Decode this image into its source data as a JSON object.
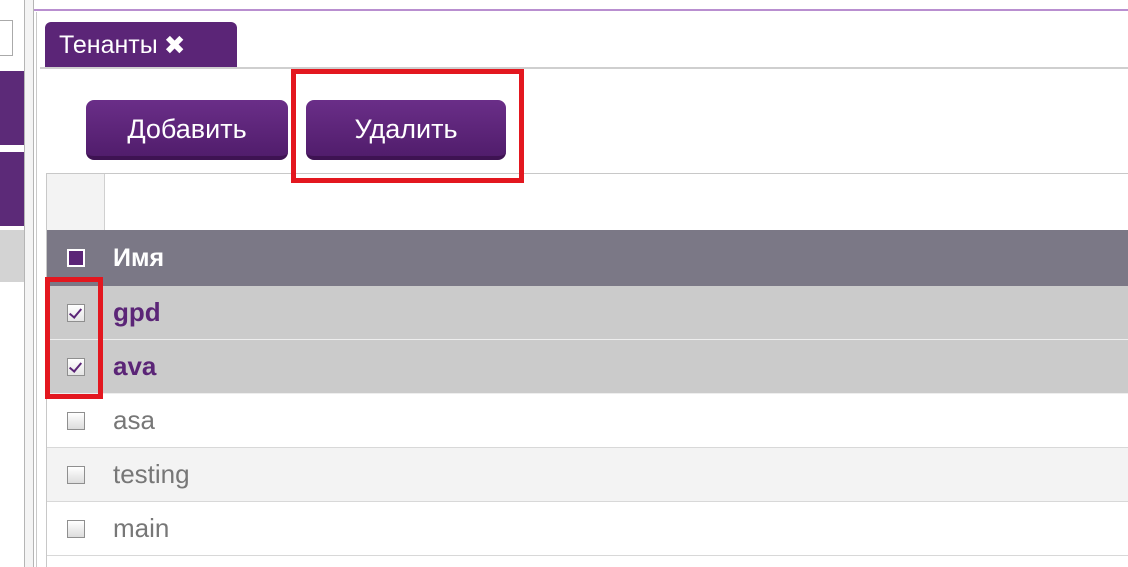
{
  "tab": {
    "label": "Тенанты",
    "close_icon": "✖"
  },
  "toolbar": {
    "add_label": "Добавить",
    "delete_label": "Удалить"
  },
  "grid": {
    "column_name_header": "Имя",
    "rows": [
      {
        "name": "gpd",
        "checked": true
      },
      {
        "name": "ava",
        "checked": true
      },
      {
        "name": "asa",
        "checked": false
      },
      {
        "name": "testing",
        "checked": false
      },
      {
        "name": "main",
        "checked": false
      }
    ]
  },
  "colors": {
    "brand_purple": "#5b2577",
    "header_gray": "#7b7886",
    "selected_row": "#cbcbcb",
    "highlight_red": "#e3171f"
  }
}
